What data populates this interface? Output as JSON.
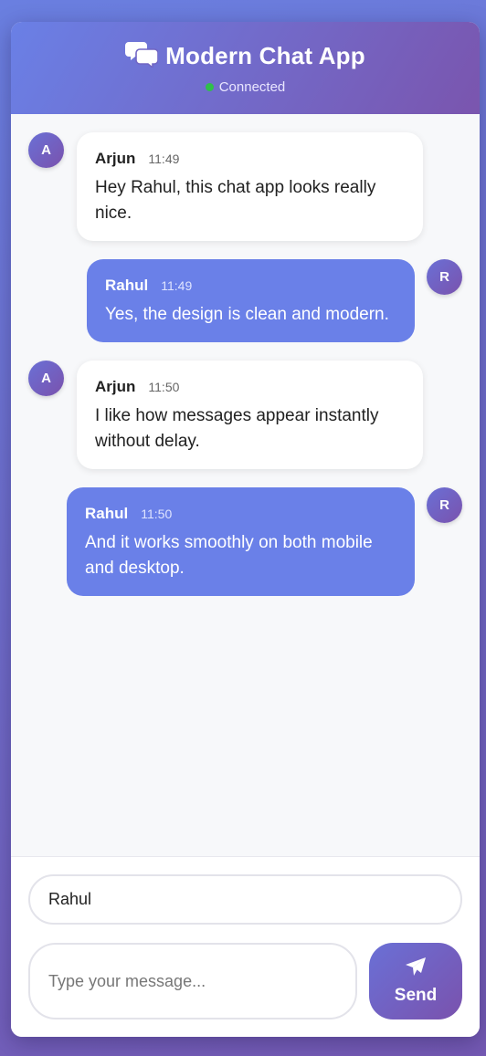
{
  "header": {
    "title": "Modern Chat App",
    "status": "Connected",
    "status_color": "#2fbf4a"
  },
  "messages": [
    {
      "sender": "Arjun",
      "avatar": "A",
      "time": "11:49",
      "text": "Hey Rahul, this chat app looks really nice.",
      "direction": "incoming"
    },
    {
      "sender": "Rahul",
      "avatar": "R",
      "time": "11:49",
      "text": "Yes, the design is clean and modern.",
      "direction": "outgoing"
    },
    {
      "sender": "Arjun",
      "avatar": "A",
      "time": "11:50",
      "text": "I like how messages appear instantly without delay.",
      "direction": "incoming"
    },
    {
      "sender": "Rahul",
      "avatar": "R",
      "time": "11:50",
      "text": "And it works smoothly on both mobile and desktop.",
      "direction": "outgoing"
    }
  ],
  "composer": {
    "name_value": "Rahul",
    "message_placeholder": "Type your message...",
    "send_label": "Send"
  },
  "colors": {
    "accent": "#6a80e8",
    "brand_gradient_start": "#6a80e6",
    "brand_gradient_end": "#7a55ae"
  },
  "icons": {
    "title": "chat-bubbles-icon",
    "send": "paper-plane-icon"
  }
}
